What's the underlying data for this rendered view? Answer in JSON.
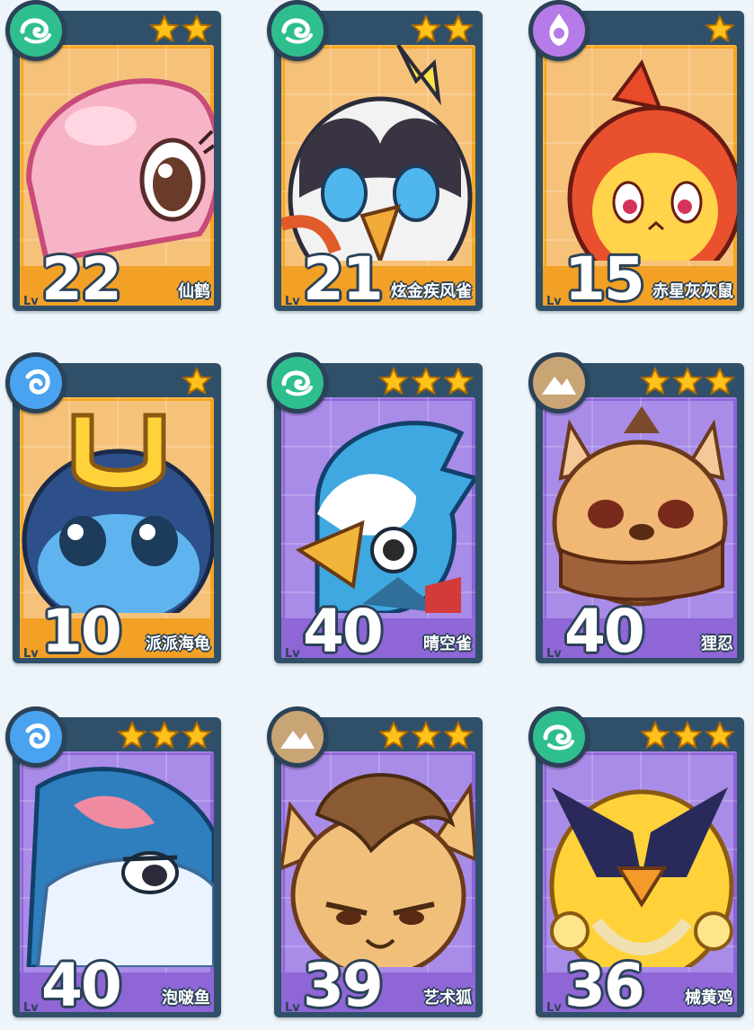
{
  "cards": [
    {
      "level_label": "Lv",
      "level": "22",
      "name": "仙鹤",
      "stars": 2,
      "type_icon": "wind-type-icon",
      "frame": "orange"
    },
    {
      "level_label": "Lv",
      "level": "21",
      "name": "炫金疾风雀",
      "stars": 2,
      "type_icon": "wind-type-icon",
      "frame": "orange"
    },
    {
      "level_label": "Lv",
      "level": "15",
      "name": "赤星灰灰鼠",
      "stars": 1,
      "type_icon": "illusion-type-icon",
      "frame": "orange"
    },
    {
      "level_label": "Lv",
      "level": "10",
      "name": "派派海龟",
      "stars": 1,
      "type_icon": "water-type-icon",
      "frame": "orange"
    },
    {
      "level_label": "Lv",
      "level": "40",
      "name": "晴空雀",
      "stars": 3,
      "type_icon": "wind-type-icon",
      "frame": "purple"
    },
    {
      "level_label": "Lv",
      "level": "40",
      "name": "狸忍",
      "stars": 3,
      "type_icon": "earth-type-icon",
      "frame": "purple"
    },
    {
      "level_label": "Lv",
      "level": "40",
      "name": "泡啵鱼",
      "stars": 3,
      "type_icon": "water-type-icon",
      "frame": "purple"
    },
    {
      "level_label": "Lv",
      "level": "39",
      "name": "艺术狐",
      "stars": 3,
      "type_icon": "earth-type-icon",
      "frame": "purple"
    },
    {
      "level_label": "Lv",
      "level": "36",
      "name": "械黄鸡",
      "stars": 3,
      "type_icon": "wind-type-icon",
      "frame": "purple"
    }
  ],
  "colors": {
    "frame_dark": "#2f5068",
    "orange_art": "#f6c27a",
    "orange_bar": "#f3a126",
    "purple_art": "#a98be8",
    "purple_bar": "#8f66d6",
    "star": "#ffc21a",
    "wind_type": "#2fbf8f",
    "water_type": "#4aa3f0",
    "illusion_type": "#b57be8",
    "earth_type": "#c9a475"
  }
}
